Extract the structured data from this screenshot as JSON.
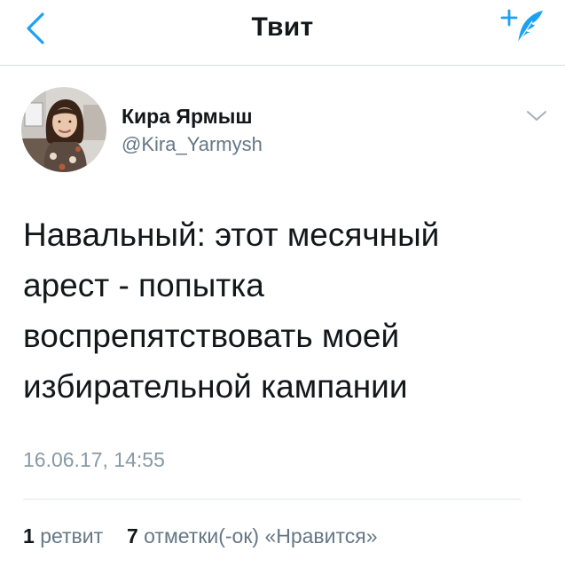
{
  "colors": {
    "accent": "#1da1f2",
    "text": "#14171a",
    "secondary": "#657786",
    "timestamp": "#8899a6",
    "divider": "#e1e8ed"
  },
  "nav": {
    "back_icon": "chevron-left-icon",
    "title": "Твит",
    "compose_icon": "compose-tweet-icon"
  },
  "tweet": {
    "author": {
      "display_name": "Кира Ярмыш",
      "handle": "@Kira_Yarmysh",
      "avatar": "avatar-photo"
    },
    "more_icon": "chevron-down-icon",
    "text_lines": [
      "Навальный: этот месячный",
      "арест - попытка",
      "воспрепятствовать моей",
      "избирательной кампании"
    ],
    "timestamp": "16.06.17, 14:55",
    "stats": {
      "retweets_count": "1",
      "retweets_label": "ретвит",
      "likes_count": "7",
      "likes_label": "отметки(-ок) «Нравится»"
    }
  }
}
